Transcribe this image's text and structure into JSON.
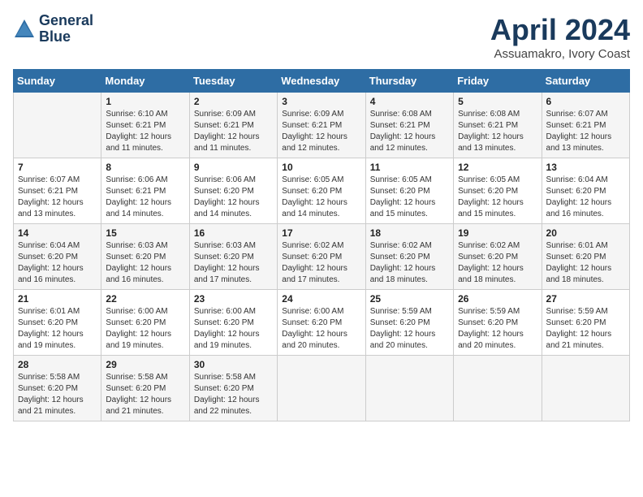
{
  "logo": {
    "line1": "General",
    "line2": "Blue"
  },
  "title": "April 2024",
  "subtitle": "Assuamakro, Ivory Coast",
  "days_header": [
    "Sunday",
    "Monday",
    "Tuesday",
    "Wednesday",
    "Thursday",
    "Friday",
    "Saturday"
  ],
  "weeks": [
    [
      {
        "day": "",
        "sunrise": "",
        "sunset": "",
        "daylight": ""
      },
      {
        "day": "1",
        "sunrise": "Sunrise: 6:10 AM",
        "sunset": "Sunset: 6:21 PM",
        "daylight": "Daylight: 12 hours and 11 minutes."
      },
      {
        "day": "2",
        "sunrise": "Sunrise: 6:09 AM",
        "sunset": "Sunset: 6:21 PM",
        "daylight": "Daylight: 12 hours and 11 minutes."
      },
      {
        "day": "3",
        "sunrise": "Sunrise: 6:09 AM",
        "sunset": "Sunset: 6:21 PM",
        "daylight": "Daylight: 12 hours and 12 minutes."
      },
      {
        "day": "4",
        "sunrise": "Sunrise: 6:08 AM",
        "sunset": "Sunset: 6:21 PM",
        "daylight": "Daylight: 12 hours and 12 minutes."
      },
      {
        "day": "5",
        "sunrise": "Sunrise: 6:08 AM",
        "sunset": "Sunset: 6:21 PM",
        "daylight": "Daylight: 12 hours and 13 minutes."
      },
      {
        "day": "6",
        "sunrise": "Sunrise: 6:07 AM",
        "sunset": "Sunset: 6:21 PM",
        "daylight": "Daylight: 12 hours and 13 minutes."
      }
    ],
    [
      {
        "day": "7",
        "sunrise": "Sunrise: 6:07 AM",
        "sunset": "Sunset: 6:21 PM",
        "daylight": "Daylight: 12 hours and 13 minutes."
      },
      {
        "day": "8",
        "sunrise": "Sunrise: 6:06 AM",
        "sunset": "Sunset: 6:21 PM",
        "daylight": "Daylight: 12 hours and 14 minutes."
      },
      {
        "day": "9",
        "sunrise": "Sunrise: 6:06 AM",
        "sunset": "Sunset: 6:20 PM",
        "daylight": "Daylight: 12 hours and 14 minutes."
      },
      {
        "day": "10",
        "sunrise": "Sunrise: 6:05 AM",
        "sunset": "Sunset: 6:20 PM",
        "daylight": "Daylight: 12 hours and 14 minutes."
      },
      {
        "day": "11",
        "sunrise": "Sunrise: 6:05 AM",
        "sunset": "Sunset: 6:20 PM",
        "daylight": "Daylight: 12 hours and 15 minutes."
      },
      {
        "day": "12",
        "sunrise": "Sunrise: 6:05 AM",
        "sunset": "Sunset: 6:20 PM",
        "daylight": "Daylight: 12 hours and 15 minutes."
      },
      {
        "day": "13",
        "sunrise": "Sunrise: 6:04 AM",
        "sunset": "Sunset: 6:20 PM",
        "daylight": "Daylight: 12 hours and 16 minutes."
      }
    ],
    [
      {
        "day": "14",
        "sunrise": "Sunrise: 6:04 AM",
        "sunset": "Sunset: 6:20 PM",
        "daylight": "Daylight: 12 hours and 16 minutes."
      },
      {
        "day": "15",
        "sunrise": "Sunrise: 6:03 AM",
        "sunset": "Sunset: 6:20 PM",
        "daylight": "Daylight: 12 hours and 16 minutes."
      },
      {
        "day": "16",
        "sunrise": "Sunrise: 6:03 AM",
        "sunset": "Sunset: 6:20 PM",
        "daylight": "Daylight: 12 hours and 17 minutes."
      },
      {
        "day": "17",
        "sunrise": "Sunrise: 6:02 AM",
        "sunset": "Sunset: 6:20 PM",
        "daylight": "Daylight: 12 hours and 17 minutes."
      },
      {
        "day": "18",
        "sunrise": "Sunrise: 6:02 AM",
        "sunset": "Sunset: 6:20 PM",
        "daylight": "Daylight: 12 hours and 18 minutes."
      },
      {
        "day": "19",
        "sunrise": "Sunrise: 6:02 AM",
        "sunset": "Sunset: 6:20 PM",
        "daylight": "Daylight: 12 hours and 18 minutes."
      },
      {
        "day": "20",
        "sunrise": "Sunrise: 6:01 AM",
        "sunset": "Sunset: 6:20 PM",
        "daylight": "Daylight: 12 hours and 18 minutes."
      }
    ],
    [
      {
        "day": "21",
        "sunrise": "Sunrise: 6:01 AM",
        "sunset": "Sunset: 6:20 PM",
        "daylight": "Daylight: 12 hours and 19 minutes."
      },
      {
        "day": "22",
        "sunrise": "Sunrise: 6:00 AM",
        "sunset": "Sunset: 6:20 PM",
        "daylight": "Daylight: 12 hours and 19 minutes."
      },
      {
        "day": "23",
        "sunrise": "Sunrise: 6:00 AM",
        "sunset": "Sunset: 6:20 PM",
        "daylight": "Daylight: 12 hours and 19 minutes."
      },
      {
        "day": "24",
        "sunrise": "Sunrise: 6:00 AM",
        "sunset": "Sunset: 6:20 PM",
        "daylight": "Daylight: 12 hours and 20 minutes."
      },
      {
        "day": "25",
        "sunrise": "Sunrise: 5:59 AM",
        "sunset": "Sunset: 6:20 PM",
        "daylight": "Daylight: 12 hours and 20 minutes."
      },
      {
        "day": "26",
        "sunrise": "Sunrise: 5:59 AM",
        "sunset": "Sunset: 6:20 PM",
        "daylight": "Daylight: 12 hours and 20 minutes."
      },
      {
        "day": "27",
        "sunrise": "Sunrise: 5:59 AM",
        "sunset": "Sunset: 6:20 PM",
        "daylight": "Daylight: 12 hours and 21 minutes."
      }
    ],
    [
      {
        "day": "28",
        "sunrise": "Sunrise: 5:58 AM",
        "sunset": "Sunset: 6:20 PM",
        "daylight": "Daylight: 12 hours and 21 minutes."
      },
      {
        "day": "29",
        "sunrise": "Sunrise: 5:58 AM",
        "sunset": "Sunset: 6:20 PM",
        "daylight": "Daylight: 12 hours and 21 minutes."
      },
      {
        "day": "30",
        "sunrise": "Sunrise: 5:58 AM",
        "sunset": "Sunset: 6:20 PM",
        "daylight": "Daylight: 12 hours and 22 minutes."
      },
      {
        "day": "",
        "sunrise": "",
        "sunset": "",
        "daylight": ""
      },
      {
        "day": "",
        "sunrise": "",
        "sunset": "",
        "daylight": ""
      },
      {
        "day": "",
        "sunrise": "",
        "sunset": "",
        "daylight": ""
      },
      {
        "day": "",
        "sunrise": "",
        "sunset": "",
        "daylight": ""
      }
    ]
  ]
}
